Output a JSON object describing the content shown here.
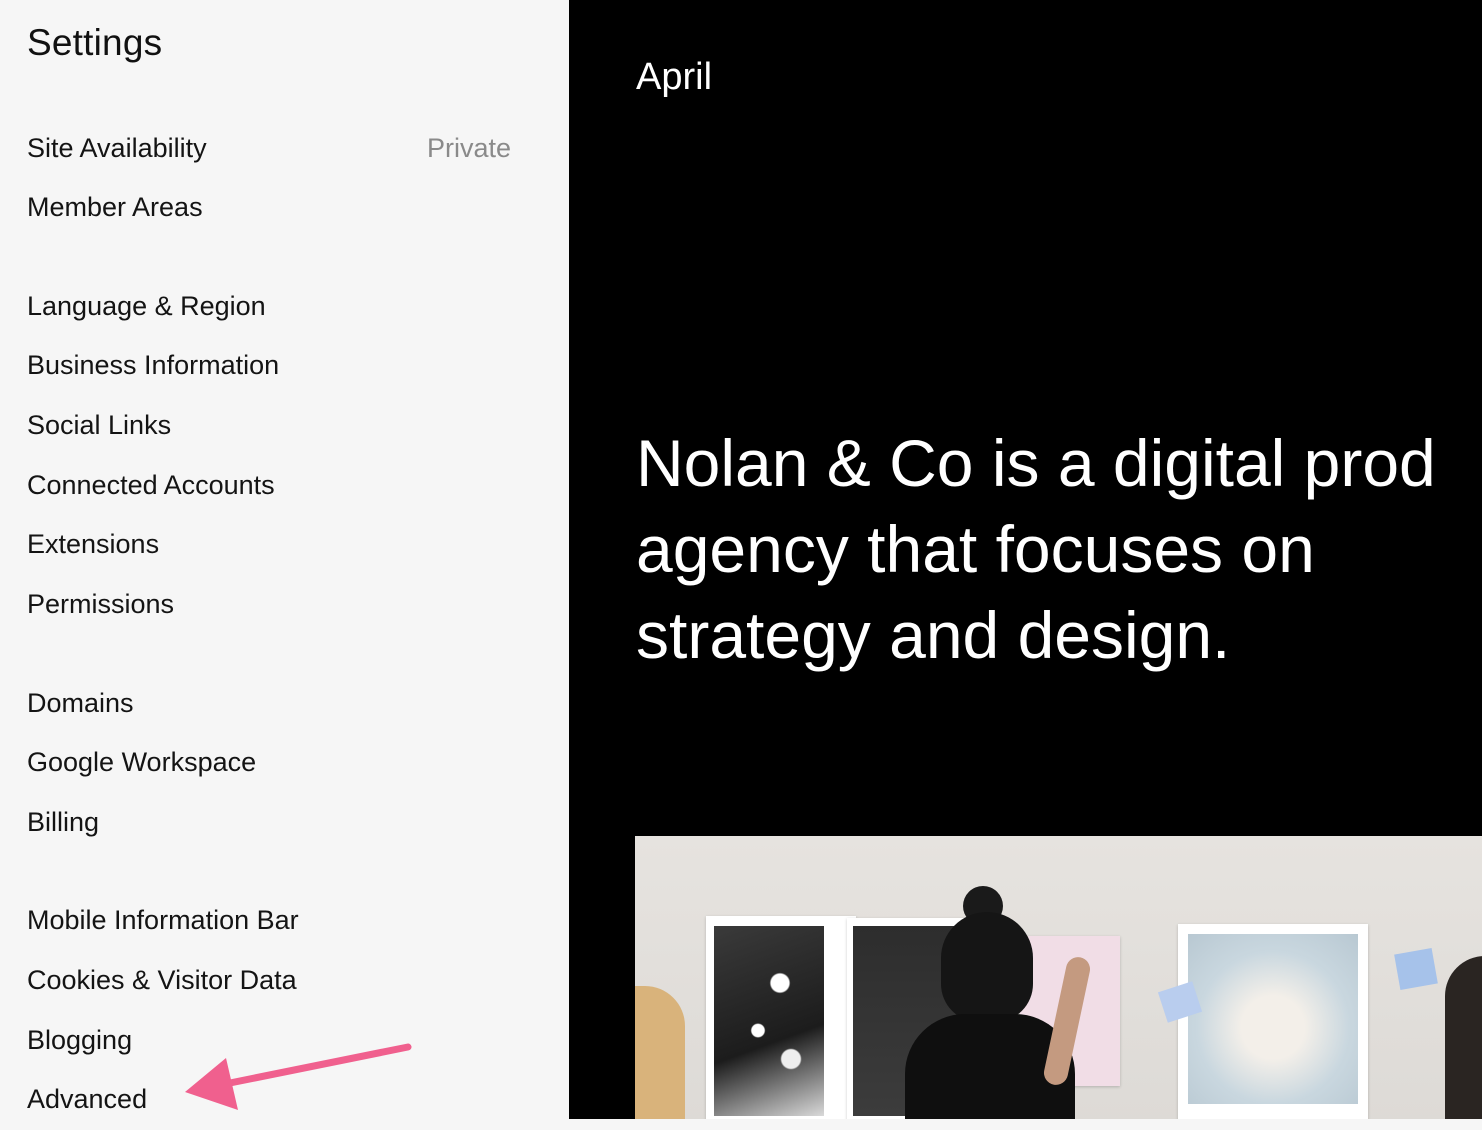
{
  "sidebar": {
    "title": "Settings",
    "items": [
      {
        "label": "Site Availability",
        "value": "Private"
      },
      {
        "label": "Member Areas"
      },
      {
        "label": "Language & Region"
      },
      {
        "label": "Business Information"
      },
      {
        "label": "Social Links"
      },
      {
        "label": "Connected Accounts"
      },
      {
        "label": "Extensions"
      },
      {
        "label": "Permissions"
      },
      {
        "label": "Domains"
      },
      {
        "label": "Google Workspace"
      },
      {
        "label": "Billing"
      },
      {
        "label": "Mobile Information Bar"
      },
      {
        "label": "Cookies & Visitor Data"
      },
      {
        "label": "Blogging"
      },
      {
        "label": "Advanced"
      }
    ]
  },
  "preview": {
    "site_name": "April",
    "headline_lines": [
      "Nolan & Co is a digital prod",
      "agency that focuses on",
      "strategy and design."
    ]
  },
  "annotation": {
    "arrow_color": "#f0608e",
    "arrow_target": "Advanced"
  },
  "colors": {
    "sidebar_bg": "#f6f6f6",
    "preview_bg": "#000000",
    "muted_text": "#8a8a8a"
  }
}
